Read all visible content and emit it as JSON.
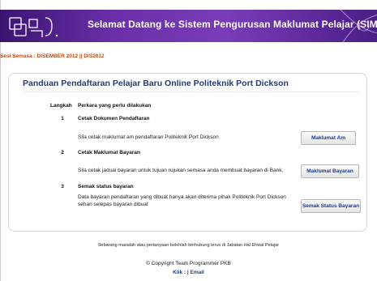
{
  "banner": {
    "title": "Selamat Datang ke Sistem Pengurusan Maklumat Pelajar (SIMS)",
    "colors": {
      "start": "#3a1470",
      "mid": "#7a3cb8",
      "end": "#4b1d86"
    }
  },
  "session": {
    "text": "Sesi Semasa : DISEMBER 2012 || DIS2012",
    "color": "#c9470f"
  },
  "main": {
    "title": "Panduan Pendaftaran Pelajar Baru Online Politeknik Port Dickson",
    "headers": {
      "step": "Langkah",
      "action": "Perkara yang perlu dilakukan"
    },
    "steps": [
      {
        "num": "1",
        "title": "Cetak Dokumen Pendaftaran",
        "desc": "Sila cetak maklumat am pendaftaran Politeknik Port Dickson",
        "button": "Maklumat Am"
      },
      {
        "num": "2",
        "title": "Cetak Maklumat Bayaran",
        "desc": "Sila cetak jadual bayaran untuk tujuan rujukan semasa anda membuat bayaran di Bank.",
        "button": "Maklumat Bayaran"
      },
      {
        "num": "3",
        "title": "Semak status bayaran",
        "desc": "Data bayaran pendaftaran yang dibuat hanya akan diterima pihak Politeknik Port Dickson sehari selepas bayaran dibuat",
        "button": "Semak Status Bayaran"
      }
    ]
  },
  "footer": {
    "note": "Sebarang masalah atau pertanyaan bolehlah berhubung terus di Jabatan Hal Ehwal Pelajar",
    "copyright": "© Copyright Team Programmer PKB",
    "link_klik": "Klik",
    "separator": " : | ",
    "link_email": "Email"
  }
}
